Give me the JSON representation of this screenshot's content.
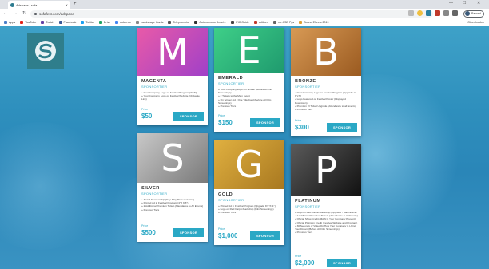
{
  "browser": {
    "tab_title": "Adspace | sofa",
    "url": "sofafest.com/adspace",
    "profile_label": "Paused",
    "bookmarks": [
      {
        "label": "Apps",
        "color": "#4a7ec8"
      },
      {
        "label": "YouTube",
        "color": "#e62117"
      },
      {
        "label": "Twitch",
        "color": "#6441a5"
      },
      {
        "label": "Facebook",
        "color": "#3b5998"
      },
      {
        "label": "Twitter",
        "color": "#1da1f2"
      },
      {
        "label": "Drive",
        "color": "#1fa463"
      },
      {
        "label": "Adsense",
        "color": "#4285f4"
      },
      {
        "label": "Landscape Cards",
        "color": "#888888"
      },
      {
        "label": "Telepromptor",
        "color": "#555555"
      },
      {
        "label": "Autonomous Smart...",
        "color": "#333333"
      },
      {
        "label": "PIC Guide",
        "color": "#444444"
      },
      {
        "label": "editions",
        "color": "#c0392b"
      },
      {
        "label": "cs: ASD Pgs",
        "color": "#666666"
      },
      {
        "label": "Sound Effects 2019",
        "color": "#e0a030"
      }
    ],
    "other_bookmarks": "Other bookm"
  },
  "page": {
    "sponsor_label": "SPONSORTIER",
    "price_label": "Price",
    "button_label": "SPONSOR",
    "tiers": [
      {
        "letter": "M",
        "name": "MAGENTA",
        "price": "$50",
        "colors": [
          "#e85aa8",
          "#a040c8"
        ],
        "features": [
          "» Your Company Logo on Festival Program (7\"x3\")",
          "» Your Company Logo on Festival Website (Clickable Link)"
        ]
      },
      {
        "letter": "E",
        "name": "EMERALD",
        "price": "$150",
        "colors": [
          "#3ecf88",
          "#1f9a6e"
        ],
        "features": [
          "» Your Company Logo On Screen (Before All Film Screenings)",
          "» 2 Tickets to the Main Event",
          "» On Screen Ad - One Title Card (Before All Film Screenings)",
          "» Previous Tiers"
        ]
      },
      {
        "letter": "B",
        "name": "BRONZE",
        "price": "$300",
        "colors": [
          "#d89a55",
          "#9a5a20"
        ],
        "features": [
          "» Your Company Logo on Festival Program (Upgrade to 9\"x7\")",
          "» Logo Featured on Festival Poster (Displayed Downtown)",
          "» Premium VI Ticket Upgrade (Attendance to all Events)",
          "» Previous Tiers"
        ]
      },
      {
        "letter": "S",
        "name": "SILVER",
        "price": "$500",
        "colors": [
          "#c8c8c8",
          "#7a7a7a"
        ],
        "features": [
          "» Award Sponsorship (Say: May Present Award)",
          "» Printed Ad in Festival Program (4\"X 9.5\")",
          "» 2 Additional Premium Ticket (Attendance to All Events)",
          "» Previous Tiers"
        ]
      },
      {
        "letter": "G",
        "name": "GOLD",
        "price": "$1,000",
        "colors": [
          "#e0b040",
          "#a87820"
        ],
        "features": [
          "» Printed Ad in Festival Program (Upgrade 8.5\"X11\")",
          "» Logo on Red Carpet Backdrop (Film Screenings)",
          "» Previous Tiers"
        ]
      },
      {
        "letter": "P",
        "name": "PLATINUM",
        "price": "$2,000",
        "colors": [
          "#5a5a5a",
          "#111111"
        ],
        "features": [
          "» Logo on Red Carpet Backdrop (Upgrade - Main Event)",
          "» 2 Additional Premium Tickets (Attendance to All Events)",
          "» Official Show Credit (MAIN & Your Company Present)",
          "» Official Platinum Credit (Festival Website and Program)",
          "» 30 Seconds of Video On How Your Company is Living Your Dream (Before All Film Screenings)",
          "» Previous Tiers"
        ]
      }
    ]
  }
}
